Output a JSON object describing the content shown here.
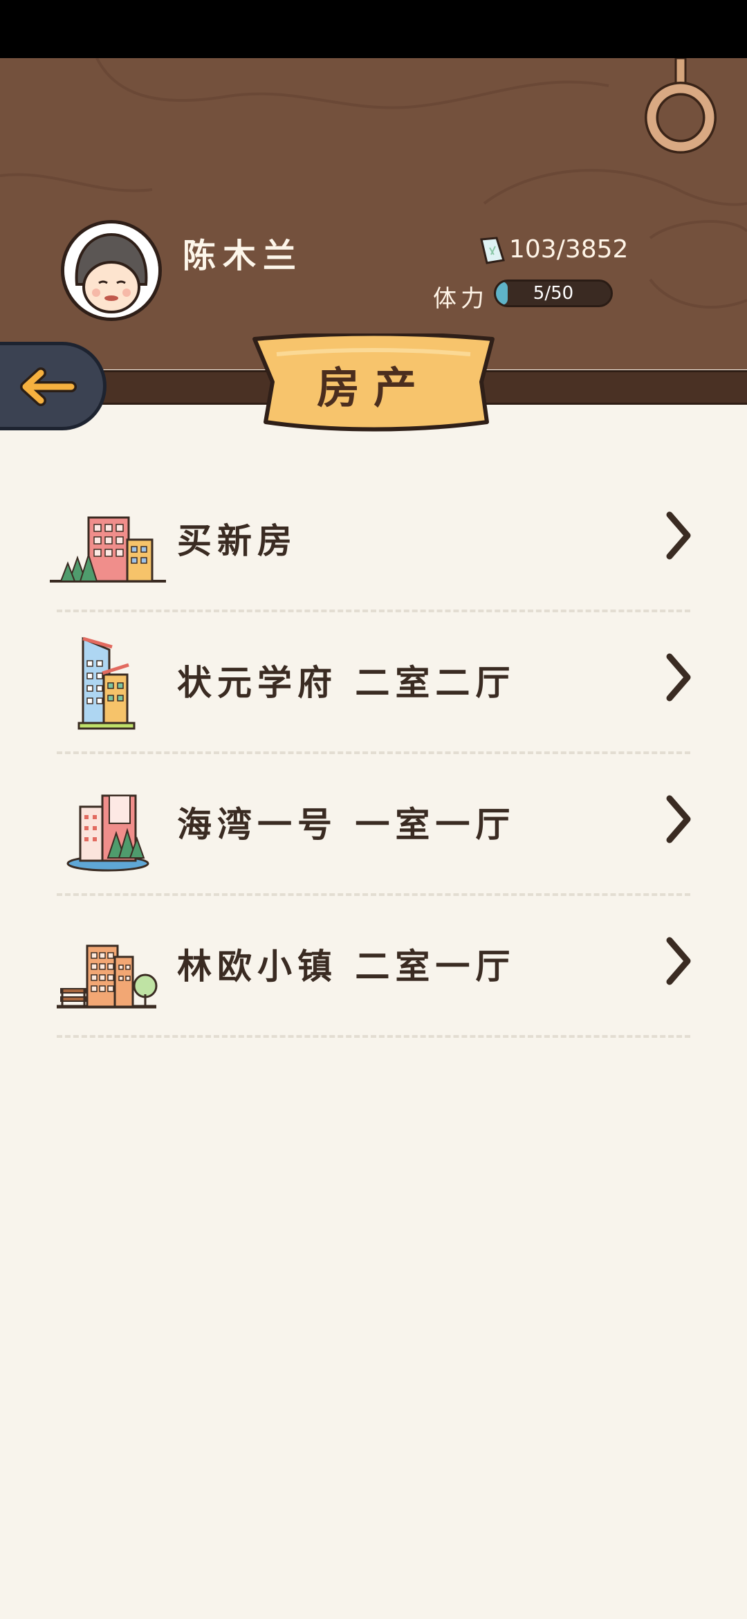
{
  "header": {
    "player_name": "陈木兰",
    "money": "103/3852",
    "stamina_label": "体力",
    "stamina_text": "5/50",
    "stamina_fraction": 0.1
  },
  "page_title": "房产",
  "list": {
    "items": [
      {
        "label": "买新房",
        "icon": "buy-house-icon"
      },
      {
        "label": "状元学府  二室二厅",
        "icon": "tower-building-icon"
      },
      {
        "label": "海湾一号  一室一厅",
        "icon": "bay-buildings-icon"
      },
      {
        "label": "林欧小镇  二室一厅",
        "icon": "town-building-icon"
      }
    ]
  },
  "colors": {
    "wood": "#74513d",
    "banner": "#f7c46c",
    "background": "#f8f4ec",
    "stamina": "#5fb3c8"
  }
}
